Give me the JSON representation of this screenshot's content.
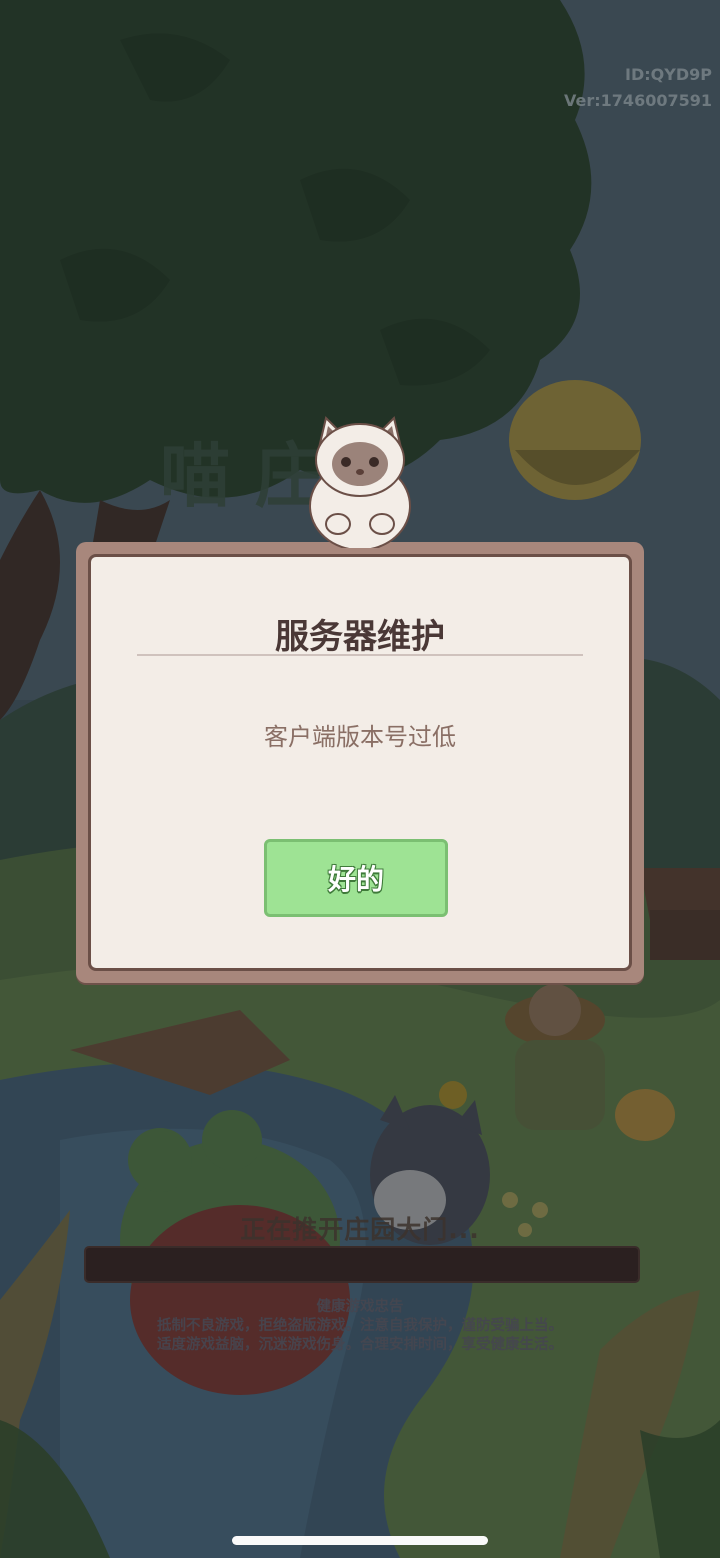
{
  "version_info": {
    "id": "ID:QYD9P",
    "version": "Ver:1746007591"
  },
  "game_logo_text": "喵 庄园",
  "loading": {
    "text": "正在推开庄园大门...",
    "progress": 0
  },
  "health_notice": {
    "title": "健康游戏忠告",
    "line1": "抵制不良游戏，拒绝盗版游戏。注意自我保护，谨防受骗上当。",
    "line2": "适度游戏益脑，沉迷游戏伤身。合理安排时间，享受健康生活。"
  },
  "dialog": {
    "title": "服务器维护",
    "message": "客户端版本号过低",
    "ok_label": "好的"
  },
  "colors": {
    "button_green": "#9ee394",
    "dialog_frame": "#a8877c",
    "dialog_bg": "#f3ede7"
  }
}
